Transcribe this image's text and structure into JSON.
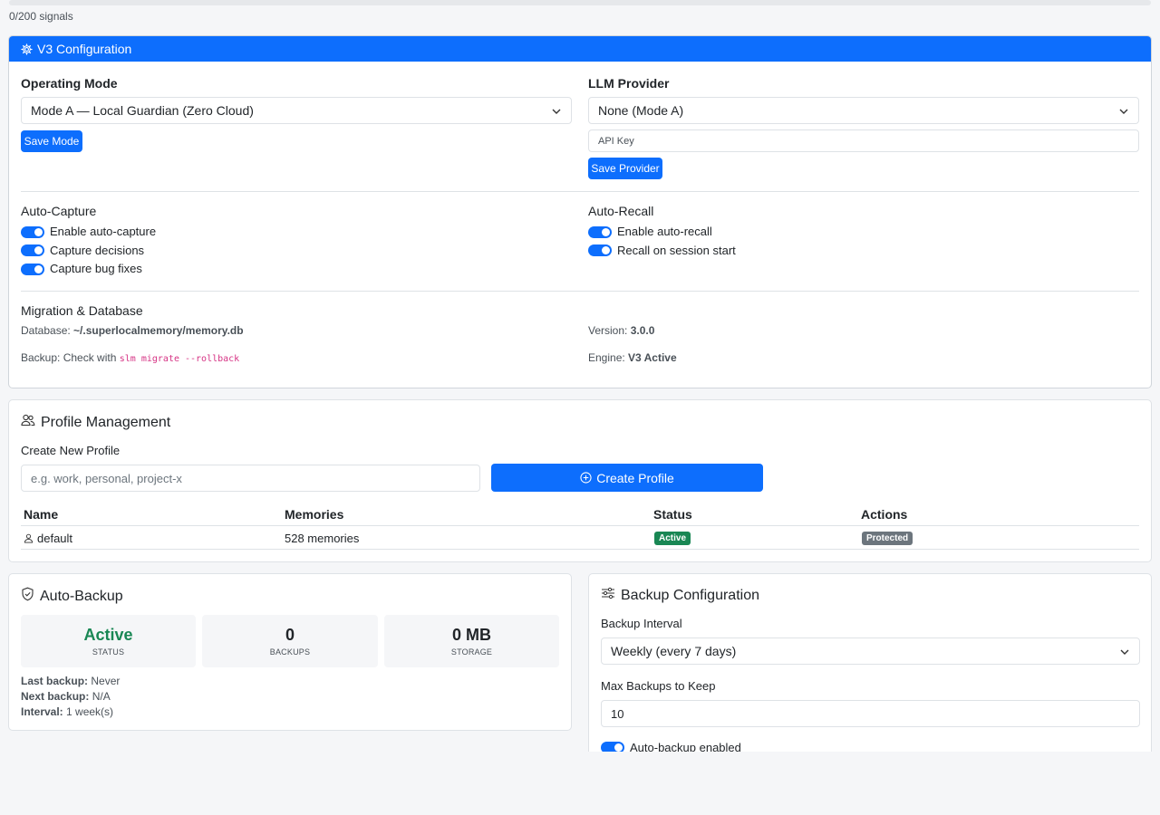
{
  "signals": {
    "text": "0/200 signals",
    "progress": 0
  },
  "v3_config": {
    "title": "V3 Configuration",
    "operating_mode": {
      "label": "Operating Mode",
      "value": "Mode A — Local Guardian (Zero Cloud)",
      "save_label": "Save Mode"
    },
    "llm_provider": {
      "label": "LLM Provider",
      "value": "None (Mode A)",
      "api_key_placeholder": "API Key",
      "save_label": "Save Provider"
    },
    "auto_capture": {
      "title": "Auto-Capture",
      "items": [
        {
          "label": "Enable auto-capture",
          "on": true
        },
        {
          "label": "Capture decisions",
          "on": true
        },
        {
          "label": "Capture bug fixes",
          "on": true
        }
      ]
    },
    "auto_recall": {
      "title": "Auto-Recall",
      "items": [
        {
          "label": "Enable auto-recall",
          "on": true
        },
        {
          "label": "Recall on session start",
          "on": true
        }
      ]
    },
    "migration": {
      "title": "Migration & Database",
      "database_label": "Database:",
      "database_value": "~/.superlocalmemory/memory.db",
      "version_label": "Version:",
      "version_value": "3.0.0",
      "backup_label": "Backup: Check with",
      "backup_command": "slm migrate --rollback",
      "engine_label": "Engine:",
      "engine_value": "V3 Active"
    }
  },
  "profiles": {
    "title": "Profile Management",
    "create_label": "Create New Profile",
    "input_placeholder": "e.g. work, personal, project-x",
    "create_button": "Create Profile",
    "columns": [
      "Name",
      "Memories",
      "Status",
      "Actions"
    ],
    "rows": [
      {
        "name": "default",
        "memories": "528 memories",
        "status": "Active",
        "action": "Protected"
      }
    ]
  },
  "auto_backup": {
    "title": "Auto-Backup",
    "stats": [
      {
        "value": "Active",
        "label": "STATUS"
      },
      {
        "value": "0",
        "label": "BACKUPS"
      },
      {
        "value": "0 MB",
        "label": "STORAGE"
      }
    ],
    "last_backup_label": "Last backup:",
    "last_backup_value": "Never",
    "next_backup_label": "Next backup:",
    "next_backup_value": "N/A",
    "interval_label": "Interval:",
    "interval_value": "1 week(s)"
  },
  "backup_config": {
    "title": "Backup Configuration",
    "interval_label": "Backup Interval",
    "interval_value": "Weekly (every 7 days)",
    "max_label": "Max Backups to Keep",
    "max_value": "10",
    "enabled_label": "Auto-backup enabled"
  },
  "colors": {
    "primary": "#0d6efd",
    "success": "#198754",
    "secondary": "#6c757d",
    "code": "#d63384"
  }
}
